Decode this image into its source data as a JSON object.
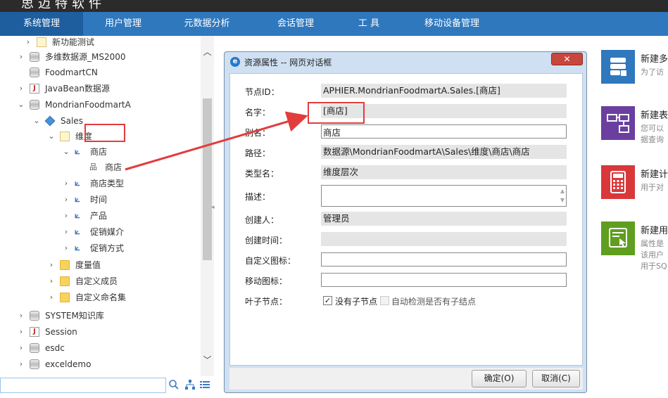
{
  "header": {
    "brand": "思迈特软件",
    "menu": [
      "系统管理",
      "用户管理",
      "元数据分析",
      "会话管理",
      "工 具",
      "移动设备管理"
    ]
  },
  "tree": {
    "nodes": [
      {
        "label": "新功能测试",
        "icon": "folder-doc-icon"
      },
      {
        "label": "多维数据源_MS2000",
        "icon": "database-icon"
      },
      {
        "label": "FoodmartCN",
        "icon": "database-icon"
      },
      {
        "label": "JavaBean数据源",
        "icon": "java-icon"
      },
      {
        "label": "MondrianFoodmartA",
        "icon": "database-icon"
      },
      {
        "label": "Sales",
        "icon": "cube-icon"
      },
      {
        "label": "维度",
        "icon": "folder-doc-icon"
      },
      {
        "label": "商店",
        "icon": "dimension-icon"
      },
      {
        "label": "商店",
        "icon": "level-icon"
      },
      {
        "label": "商店类型",
        "icon": "dimension-icon"
      },
      {
        "label": "时间",
        "icon": "dimension-icon"
      },
      {
        "label": "产品",
        "icon": "dimension-icon"
      },
      {
        "label": "促销媒介",
        "icon": "dimension-icon"
      },
      {
        "label": "促销方式",
        "icon": "dimension-icon"
      },
      {
        "label": "度量值",
        "icon": "folder-icon"
      },
      {
        "label": "自定义成员",
        "icon": "folder-icon"
      },
      {
        "label": "自定义命名集",
        "icon": "folder-icon"
      },
      {
        "label": "SYSTEM知识库",
        "icon": "database-icon"
      },
      {
        "label": "Session",
        "icon": "java-icon"
      },
      {
        "label": "esdc",
        "icon": "database-icon"
      },
      {
        "label": "exceldemo",
        "icon": "database-icon"
      }
    ],
    "search_placeholder": ""
  },
  "right_panel": {
    "cards": [
      {
        "title": "新建多",
        "desc": [
          "为了访"
        ],
        "color": "#2f78be"
      },
      {
        "title": "新建表",
        "desc": [
          "您可以",
          "据查询"
        ],
        "color": "#6a3fa0"
      },
      {
        "title": "新建计",
        "desc": [
          "用于对"
        ],
        "color": "#d9383a"
      },
      {
        "title": "新建用",
        "desc": [
          "属性是",
          "该用户",
          "用于SQ"
        ],
        "color": "#5f9e1e"
      }
    ]
  },
  "dialog": {
    "title": "资源属性 -- 网页对话框",
    "close_label": "✕",
    "fields": {
      "node_id_label": "节点ID：",
      "node_id_value": "APHIER.MondrianFoodmartA.Sales.[商店]",
      "name_label": "名字：",
      "name_value": "[商店]",
      "alias_label": "别名：",
      "alias_value": "商店",
      "path_label": "路径：",
      "path_value": "数据源\\MondrianFoodmartA\\Sales\\维度\\商店\\商店",
      "type_label": "类型名：",
      "type_value": "维度层次",
      "desc_label": "描述：",
      "desc_value": "",
      "creator_label": "创建人：",
      "creator_value": "管理员",
      "created_label": "创建时间：",
      "created_value": "",
      "custom_icon_label": "自定义图标：",
      "custom_icon_value": "",
      "mobile_icon_label": "移动图标：",
      "mobile_icon_value": "",
      "leaf_label": "叶子节点："
    },
    "checkboxes": {
      "no_children_label": "没有子节点",
      "no_children_checked": true,
      "auto_detect_label": "自动检测是否有子结点",
      "auto_detect_checked": false
    },
    "ok_label": "确定(O)",
    "cancel_label": "取消(C)"
  }
}
